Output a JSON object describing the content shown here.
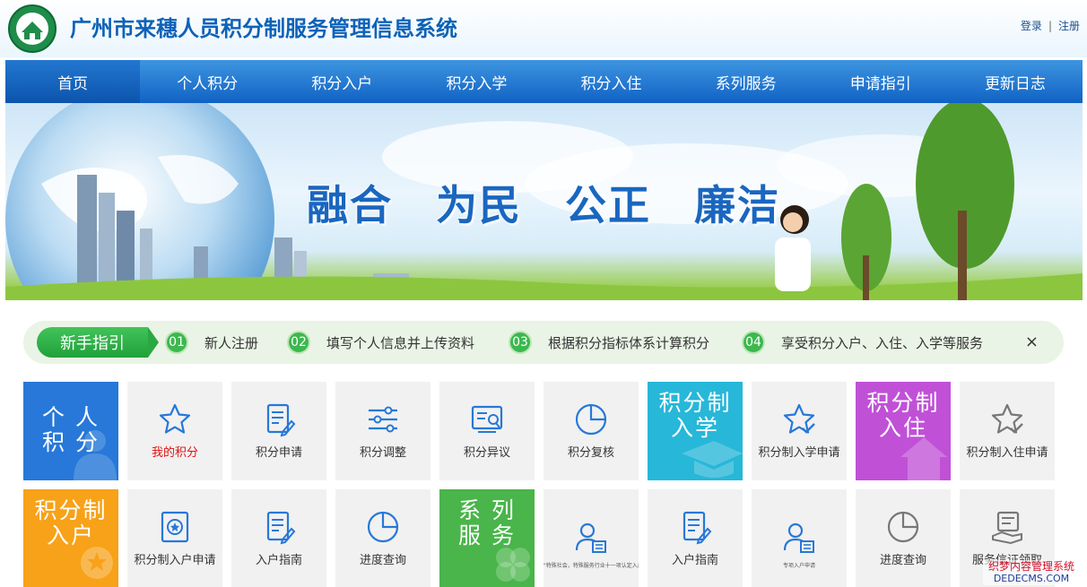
{
  "header": {
    "title": "广州市来穗人员积分制服务管理信息系统",
    "login": "登录",
    "separator": "|",
    "register": "注册"
  },
  "nav": {
    "items": [
      {
        "label": "首页",
        "active": true
      },
      {
        "label": "个人积分"
      },
      {
        "label": "积分入户"
      },
      {
        "label": "积分入学"
      },
      {
        "label": "积分入住"
      },
      {
        "label": "系列服务"
      },
      {
        "label": "申请指引"
      },
      {
        "label": "更新日志"
      }
    ]
  },
  "banner": {
    "slogan": "融合　为民　公正　廉洁"
  },
  "guide": {
    "tag": "新手指引",
    "steps": [
      {
        "num": "01",
        "text": "新人注册"
      },
      {
        "num": "02",
        "text": "填写个人信息并上传资料"
      },
      {
        "num": "03",
        "text": "根据积分指标体系计算积分"
      },
      {
        "num": "04",
        "text": "享受积分入户、入住、入学等服务"
      }
    ],
    "close": "×"
  },
  "tiles_row1": [
    {
      "type": "big",
      "text_line1": "个 人",
      "text_line2": "积 分",
      "color": "#2778d8"
    },
    {
      "icon": "star-icon",
      "label": "我的积分",
      "highlight": "#e01010"
    },
    {
      "icon": "edit-document-icon",
      "label": "积分申请"
    },
    {
      "icon": "sliders-icon",
      "label": "积分调整"
    },
    {
      "icon": "objection-document-icon",
      "label": "积分异议"
    },
    {
      "icon": "pie-chart-icon",
      "label": "积分复核"
    },
    {
      "type": "big",
      "text_line1": "积分制",
      "text_line2": "入学",
      "color": "#27b7d8"
    },
    {
      "icon": "star-check-icon",
      "label": "积分制入学申请"
    },
    {
      "type": "big",
      "text_line1": "积分制",
      "text_line2": "入住",
      "color": "#c051d7"
    },
    {
      "icon": "star-check-outline-icon",
      "label": "积分制入住申请"
    }
  ],
  "tiles_row2": [
    {
      "type": "big",
      "text_line1": "积分制",
      "text_line2": "入户",
      "color": "#f7a218"
    },
    {
      "icon": "badge-document-icon",
      "label": "积分制入户申请"
    },
    {
      "icon": "edit-document-icon",
      "label": "入户指南"
    },
    {
      "icon": "pie-chart-icon",
      "label": "进度查询"
    },
    {
      "type": "big",
      "text_line1": "系 列",
      "text_line2": "服 务",
      "color": "#49b54a"
    },
    {
      "icon": "person-document-icon",
      "label": "\"特殊社会，特殊服务行业十一项认定入户\" 入户申请"
    },
    {
      "icon": "edit-document-icon",
      "label": "入户指南"
    },
    {
      "icon": "person-document-icon",
      "label": "专项入户申请"
    },
    {
      "icon": "pie-chart-gray-icon",
      "label": "进度查询"
    },
    {
      "icon": "handshake-document-icon",
      "label": "服务信证领取"
    }
  ],
  "watermark": {
    "line1": "织梦内容管理系统",
    "line2": "DEDECMS.COM"
  }
}
